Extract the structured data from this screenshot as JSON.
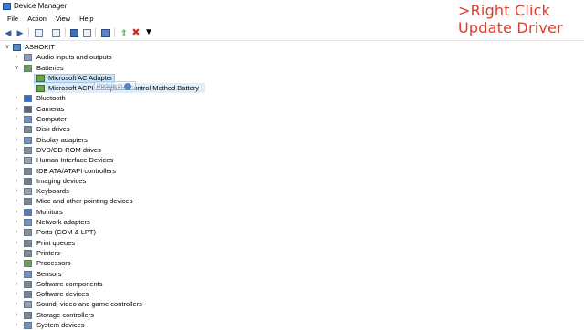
{
  "window": {
    "title": "Device Manager"
  },
  "overlay": {
    "line1": ">Right Click",
    "line2": "Update Driver",
    "color": "#e23b2a"
  },
  "menu": [
    "File",
    "Action",
    "View",
    "Help"
  ],
  "toolbar": {
    "buttons": [
      "back-icon",
      "forward-icon",
      "properties-icon",
      "show-hidden-icon",
      "help-icon",
      "details-icon",
      "scan-monitor-icon",
      "update-driver-icon",
      "uninstall-icon",
      "download-icon"
    ]
  },
  "tree": {
    "root": "ASHOKIT",
    "items": [
      {
        "label": "Audio inputs and outputs",
        "expanded": false
      },
      {
        "label": "Batteries",
        "expanded": true,
        "children": [
          "Microsoft AC Adapter",
          "Microsoft ACPI-Compliant Control Method Battery"
        ]
      },
      {
        "label": "Bluetooth",
        "expanded": false
      },
      {
        "label": "Cameras",
        "expanded": false
      },
      {
        "label": "Computer",
        "expanded": false
      },
      {
        "label": "Disk drives",
        "expanded": false
      },
      {
        "label": "Display adapters",
        "expanded": false
      },
      {
        "label": "DVD/CD-ROM drives",
        "expanded": false
      },
      {
        "label": "Human Interface Devices",
        "expanded": false
      },
      {
        "label": "IDE ATA/ATAPI controllers",
        "expanded": false
      },
      {
        "label": "Imaging devices",
        "expanded": false
      },
      {
        "label": "Keyboards",
        "expanded": false
      },
      {
        "label": "Mice and other pointing devices",
        "expanded": false
      },
      {
        "label": "Monitors",
        "expanded": false
      },
      {
        "label": "Network adapters",
        "expanded": false
      },
      {
        "label": "Ports (COM & LPT)",
        "expanded": false
      },
      {
        "label": "Print queues",
        "expanded": false
      },
      {
        "label": "Printers",
        "expanded": false
      },
      {
        "label": "Processors",
        "expanded": false
      },
      {
        "label": "Sensors",
        "expanded": false
      },
      {
        "label": "Software components",
        "expanded": false
      },
      {
        "label": "Software devices",
        "expanded": false
      },
      {
        "label": "Sound, video and game controllers",
        "expanded": false
      },
      {
        "label": "Storage controllers",
        "expanded": false
      },
      {
        "label": "System devices",
        "expanded": false
      }
    ]
  },
  "tooltip": {
    "text": "Update dr"
  }
}
